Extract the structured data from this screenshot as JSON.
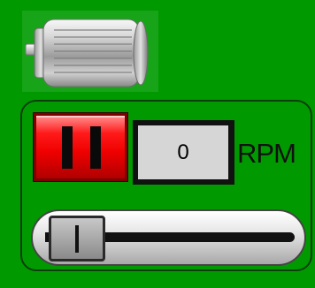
{
  "motor": {
    "icon": "motor-icon"
  },
  "control": {
    "pause_icon": "pause-icon",
    "speed_value": "0",
    "speed_unit": "RPM"
  },
  "slider": {
    "value_fraction": 0.0
  },
  "colors": {
    "background": "#009a00",
    "button_red": "#ef0000",
    "display_gray": "#d6d6d6"
  }
}
